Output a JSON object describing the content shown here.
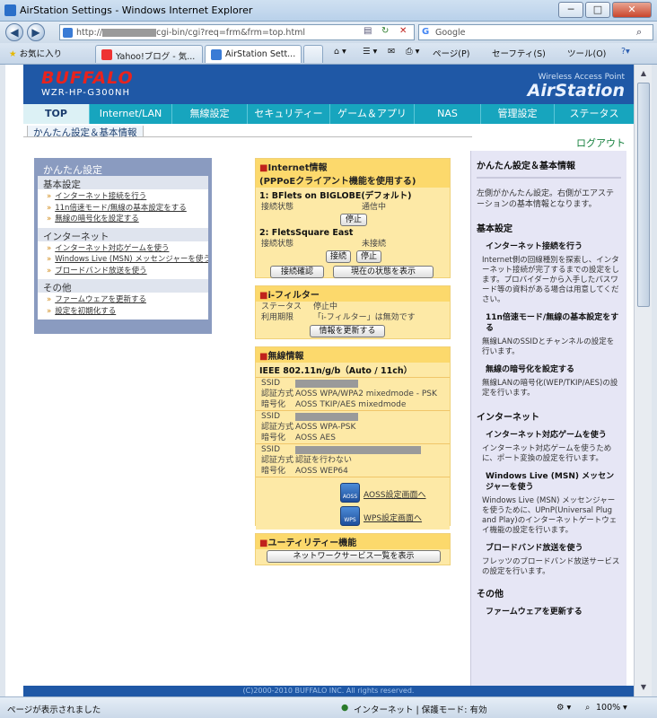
{
  "window": {
    "title": "AirStation Settings - Windows Internet Explorer",
    "minimize": "─",
    "maximize": "□",
    "close": "✕"
  },
  "address": {
    "url_prefix": "http://",
    "url_suffix": "cgi-bin/cgi?req=frm&frm=top.html",
    "search_placeholder": "Google"
  },
  "tabs": [
    {
      "label": "お気に入り"
    },
    {
      "label": "Yahoo!ブログ - 気..."
    },
    {
      "label": "AirStation Sett..."
    }
  ],
  "toolbar": {
    "page": "ページ(P)",
    "safety": "セーフティ(S)",
    "tools": "ツール(O)"
  },
  "header": {
    "brand": "BUFFALO",
    "model": "WZR-HP-G300NH",
    "tagline": "Wireless Access Point",
    "product": "AirStation"
  },
  "nav": [
    "TOP",
    "Internet/LAN",
    "無線設定",
    "セキュリティー",
    "ゲーム＆アプリ",
    "NAS",
    "管理設定",
    "ステータス"
  ],
  "breadcrumb": "かんたん設定＆基本情報",
  "logout": "ログアウト",
  "left_panel": {
    "title": "かんたん設定",
    "sections": [
      {
        "heading": "基本設定",
        "links": [
          "インターネット接続を行う",
          "11n倍速モード/無線の基本設定をする",
          "無線の暗号化を設定する"
        ]
      },
      {
        "heading": "インターネット",
        "links": [
          "インターネット対応ゲームを使う",
          "Windows Live (MSN) メッセンジャーを使う",
          "ブロードバンド放送を使う"
        ]
      },
      {
        "heading": "その他",
        "links": [
          "ファームウェアを更新する",
          "設定を初期化する"
        ]
      }
    ]
  },
  "internet": {
    "title": "Internet情報",
    "subtitle": "(PPPoEクライアント機能を使用する)",
    "conn1": {
      "name": "1: BFlets on BIGLOBE(デフォルト)",
      "label": "接続状態",
      "status": "通信中",
      "stop": "停止"
    },
    "conn2": {
      "name": "2: FletsSquare East",
      "label": "接続状態",
      "status": "未接続",
      "connect": "接続",
      "stop": "停止"
    },
    "check_button": "接続確認",
    "show_status_button": "現在の状態を表示"
  },
  "ifilter": {
    "title": "i-フィルター",
    "status_label": "ステータス",
    "status_value": "停止中",
    "period_label": "利用期限",
    "period_value": "「i-フィルター」は無効です",
    "update_button": "情報を更新する"
  },
  "wireless": {
    "title": "無線情報",
    "standard": "IEEE 802.11n/g/b（Auto / 11ch）",
    "ssid_label": "SSID",
    "auth_label": "認証方式",
    "enc_label": "暗号化",
    "entries": [
      {
        "auth": "AOSS WPA/WPA2 mixedmode - PSK",
        "enc": "AOSS TKIP/AES mixedmode"
      },
      {
        "auth": "AOSS WPA-PSK",
        "enc": "AOSS AES"
      },
      {
        "auth": "認証を行わない",
        "enc": "AOSS WEP64"
      }
    ],
    "aoss_link": "AOSS設定画面へ",
    "wps_link": "WPS設定画面へ",
    "aoss_icon_text": "AOSS",
    "wps_icon_text": "WPS"
  },
  "utility": {
    "title": "ユーティリティー機能",
    "button": "ネットワークサービス一覧を表示"
  },
  "right_panel": {
    "title": "かんたん設定＆基本情報",
    "intro": "左側がかんたん設定。右側がエアステーションの基本情報となります。",
    "basic_heading": "基本設定",
    "items": [
      {
        "title": "インターネット接続を行う",
        "desc": "Internet側の回線種別を探索し、インターネット接続が完了するまでの設定をします。プロバイダーから入手したパスワード等の資料がある場合は用意してください。"
      },
      {
        "title": "11n倍速モード/無線の基本設定をする",
        "desc": "無線LANのSSIDとチャンネルの設定を行います。"
      },
      {
        "title": "無線の暗号化を設定する",
        "desc": "無線LANの暗号化(WEP/TKIP/AES)の設定を行います。"
      }
    ],
    "internet_heading": "インターネット",
    "items2": [
      {
        "title": "インターネット対応ゲームを使う",
        "desc": "インターネット対応ゲームを使うために、ポート変換の設定を行います。"
      },
      {
        "title": "Windows Live (MSN) メッセンジャーを使う",
        "desc": "Windows Live (MSN) メッセンジャーを使うために、UPnP(Universal Plug and Play)のインターネットゲートウェイ機能の設定を行います。"
      },
      {
        "title": "ブロードバンド放送を使う",
        "desc": "フレッツのブロードバンド放送サービスの設定を行います。"
      }
    ],
    "other_heading": "その他",
    "firmware": "ファームウェアを更新する"
  },
  "footer": "(C)2000-2010 BUFFALO INC. All rights reserved.",
  "statusbar": {
    "left": "ページが表示されました",
    "zone": "インターネット | 保護モード: 有効",
    "zoom": "100%"
  },
  "colors": {
    "header_blue": "#1f58a6",
    "nav_teal": "#17a5be",
    "panel_yellow": "#fde9a6",
    "brand_red": "#e8231e",
    "logout_green": "#15803d"
  }
}
